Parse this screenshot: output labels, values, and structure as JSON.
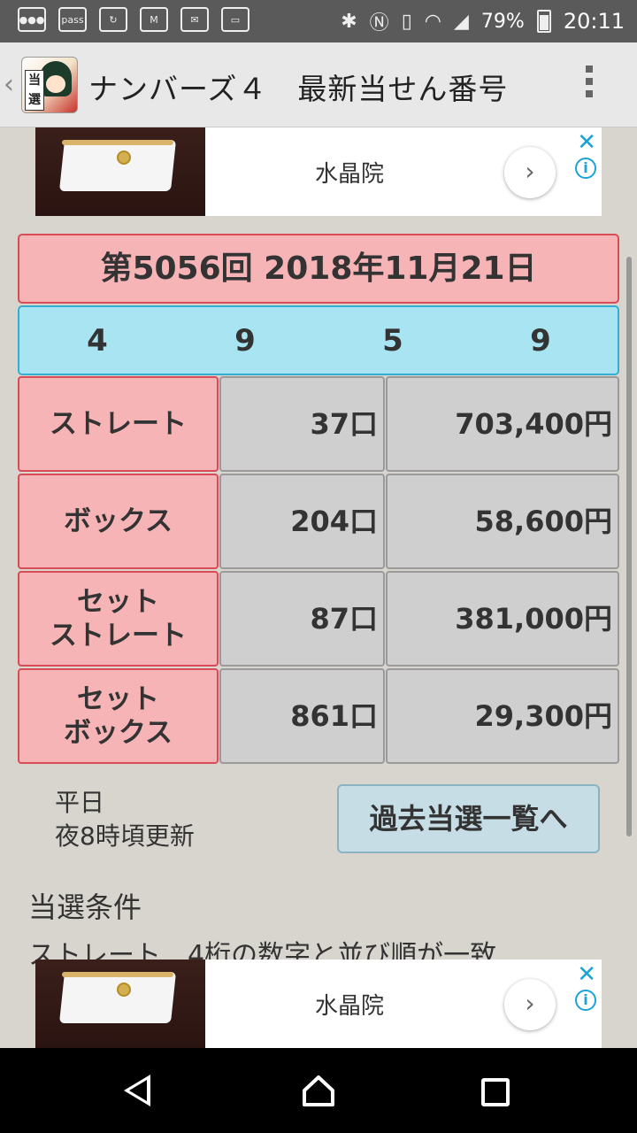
{
  "status_bar": {
    "left_icons": [
      "message-icon",
      "pass-icon",
      "sync-icon",
      "gmail-icon",
      "mail-icon",
      "mail-outline-icon"
    ],
    "pass_label": "pass",
    "battery": "79%",
    "time": "20:11"
  },
  "app_bar": {
    "title": "ナンバーズ４　最新当せん番号",
    "logo_text": "当選"
  },
  "ads": {
    "top_text": "水晶院",
    "bottom_text": "水晶院"
  },
  "result": {
    "header": "第5056回 2018年11月21日",
    "numbers": [
      "4",
      "9",
      "5",
      "9"
    ],
    "rows": [
      {
        "label": "ストレート",
        "count": "37口",
        "prize": "703,400円"
      },
      {
        "label": "ボックス",
        "count": "204口",
        "prize": "58,600円"
      },
      {
        "label": "セット\nストレート",
        "count": "87口",
        "prize": "381,000円"
      },
      {
        "label": "セット\nボックス",
        "count": "861口",
        "prize": "29,300円"
      }
    ]
  },
  "update_note": {
    "line1": "平日",
    "line2": "夜8時頃更新"
  },
  "past_button": "過去当選一覧へ",
  "conditions": {
    "title": "当選条件",
    "first_line": "ストレート　4桁の数字と並び順が一致"
  },
  "colors": {
    "pink_bg": "#f6b4b6",
    "pink_border": "#d94c55",
    "blue_bg": "#a8e4f2",
    "gray_cell": "#cfcfcf",
    "button_bg": "#c6dde6"
  }
}
